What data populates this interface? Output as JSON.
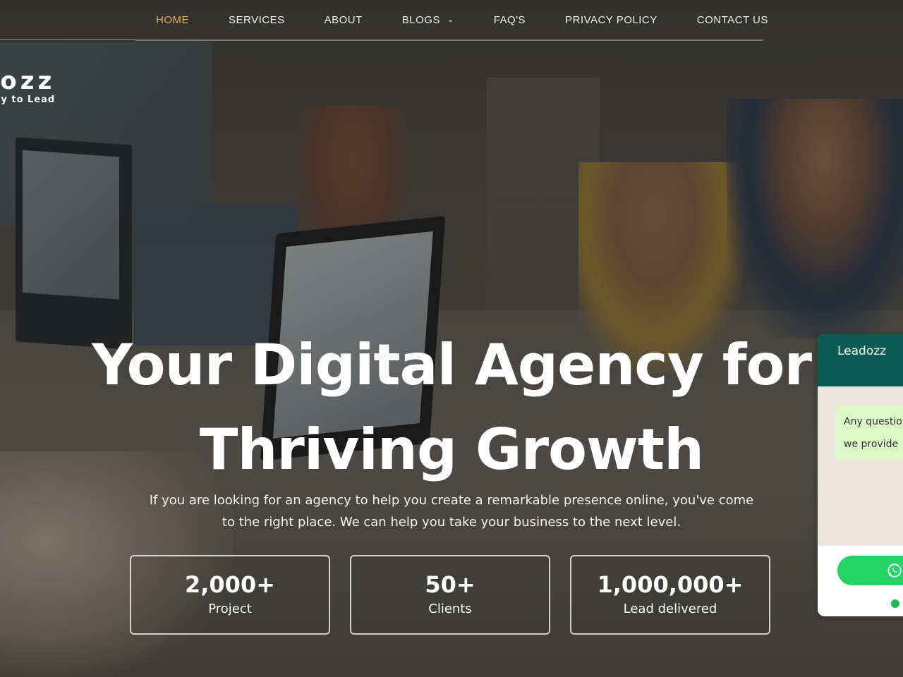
{
  "nav": {
    "items": [
      {
        "label": "HOME",
        "active": true
      },
      {
        "label": "SERVICES"
      },
      {
        "label": "ABOUT"
      },
      {
        "label": "BLOGS",
        "dropdown": true
      },
      {
        "label": "FAQ'S"
      },
      {
        "label": "PRIVACY POLICY"
      },
      {
        "label": "CONTACT US"
      }
    ],
    "active_color": "#e1b357"
  },
  "logo": {
    "wordmark": "oozz",
    "tagline": "ay to Lead"
  },
  "hero": {
    "title_line1": "Your Digital Agency for",
    "title_line2": "Thriving Growth",
    "subtitle_line1": "If you are looking for an agency to help you create a remarkable presence online, you've come",
    "subtitle_line2": "to the right place. We can help you take your business to the next level."
  },
  "stats": [
    {
      "value": "2,000+",
      "label": "Project"
    },
    {
      "value": "50+",
      "label": "Clients"
    },
    {
      "value": "1,000,000+",
      "label": "Lead delivered"
    }
  ],
  "chat_widget": {
    "title": "Leadozz",
    "message_line1": "Any questio",
    "message_line2": "we provide",
    "header_color": "#0b5c52",
    "button_color": "#25d366",
    "button_icon": "whatsapp-icon"
  }
}
